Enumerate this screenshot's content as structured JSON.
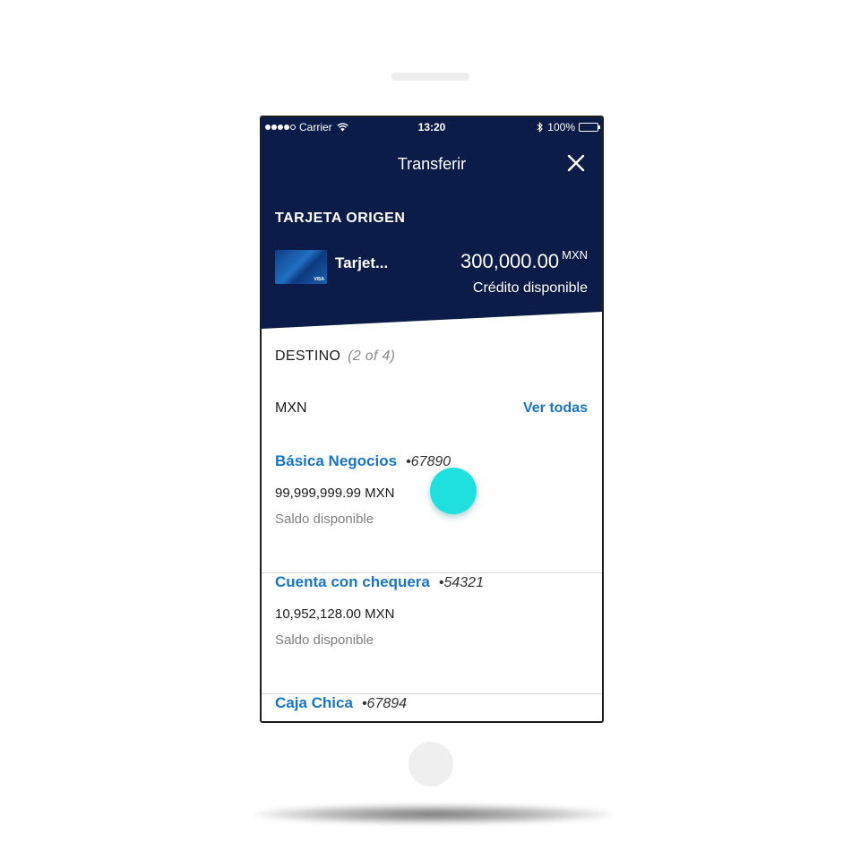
{
  "status_bar": {
    "carrier": "Carrier",
    "time": "13:20",
    "battery": "100%"
  },
  "nav": {
    "title": "Transferir",
    "close_icon": "close-icon"
  },
  "origin": {
    "section_title": "TARJETA ORIGEN",
    "card_name": "Tarjet...",
    "card_brand": "VISA",
    "amount": "300,000.00",
    "currency": "MXN",
    "amount_label": "Crédito disponible"
  },
  "destination": {
    "section_title": "DESTINO",
    "count": "(2 of 4)",
    "currency_label": "MXN",
    "see_all_label": "Ver todas",
    "accounts": [
      {
        "name": "Básica Negocios",
        "number": "•67890",
        "balance": "99,999,999.99 MXN",
        "balance_label": "Saldo disponible"
      },
      {
        "name": "Cuenta con chequera",
        "number": "•54321",
        "balance": "10,952,128.00 MXN",
        "balance_label": "Saldo disponible"
      },
      {
        "name": "Caja Chica",
        "number": "•67894",
        "balance": "",
        "balance_label": ""
      }
    ]
  },
  "colors": {
    "header_bg": "#0a1c47",
    "link_blue": "#1a74c4",
    "touch_indicator": "#1fe0de"
  }
}
